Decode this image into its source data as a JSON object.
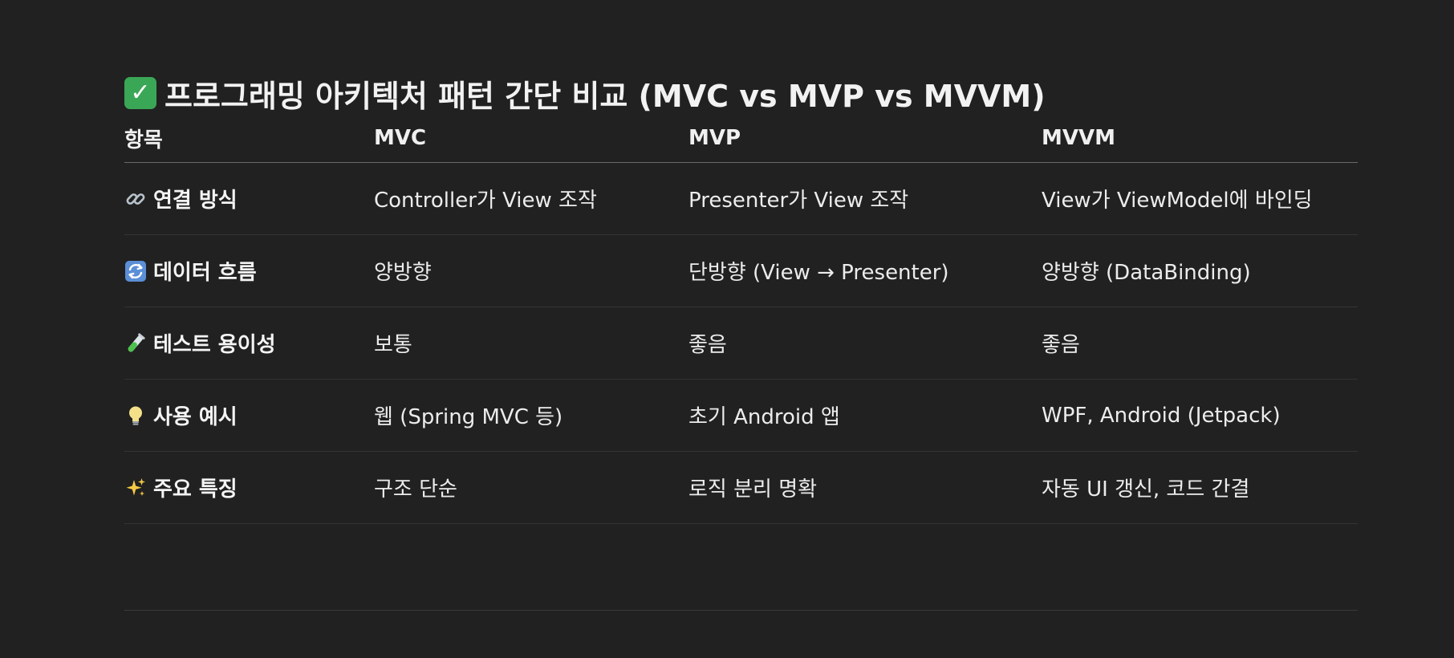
{
  "document": {
    "title_icon": "check-mark-button-icon",
    "title": "프로그래밍 아키텍처 패턴 간단 비교 (MVC vs MVP vs MVVM)",
    "table": {
      "headers": [
        "항목",
        "MVC",
        "MVP",
        "MVVM"
      ],
      "rows": [
        {
          "icon": "link-icon",
          "label": "연결 방식",
          "mvc": "Controller가 View 조작",
          "mvp": "Presenter가 View 조작",
          "mvvm": "View가 ViewModel에 바인딩"
        },
        {
          "icon": "cycle-arrows-icon",
          "label": "데이터 흐름",
          "mvc": "양방향",
          "mvp": "단방향 (View → Presenter)",
          "mvvm": "양방향 (DataBinding)"
        },
        {
          "icon": "test-tube-icon",
          "label": "테스트 용이성",
          "mvc": "보통",
          "mvp": "좋음",
          "mvvm": "좋음"
        },
        {
          "icon": "light-bulb-icon",
          "label": "사용 예시",
          "mvc": "웹 (Spring MVC 등)",
          "mvp": "초기 Android 앱",
          "mvvm": "WPF, Android (Jetpack)"
        },
        {
          "icon": "sparkles-icon",
          "label": "주요 특징",
          "mvc": "구조 단순",
          "mvp": "로직 분리 명확",
          "mvvm": "자동 UI 갱신, 코드 간결"
        }
      ]
    }
  },
  "colors": {
    "background": "#212121",
    "text": "#ececec",
    "check_green": "#3aa757",
    "header_rule": "#6a6a6a",
    "row_rule": "#343434"
  }
}
